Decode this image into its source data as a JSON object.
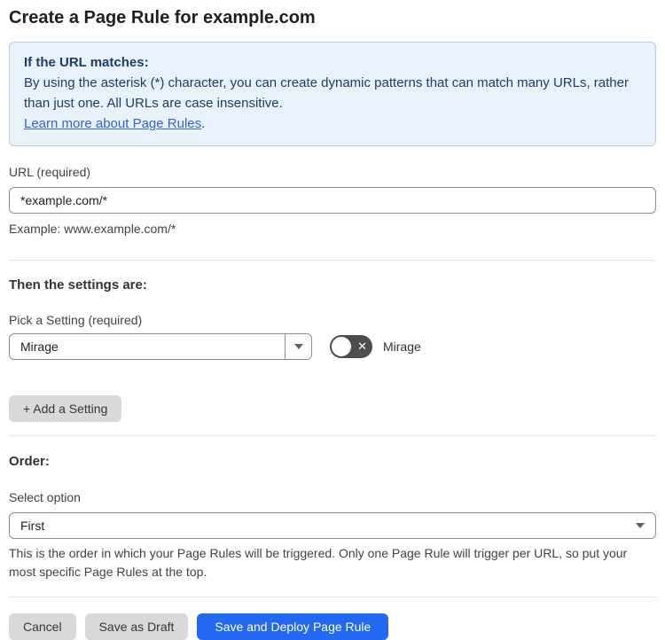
{
  "page": {
    "title": "Create a Page Rule for example.com"
  },
  "info_box": {
    "heading": "If the URL matches:",
    "body": "By using the asterisk (*) character, you can create dynamic patterns that can match many URLs, rather than just one. All URLs are case insensitive.",
    "link_label": "Learn more about Page Rules",
    "link_suffix": "."
  },
  "url_field": {
    "label": "URL (required)",
    "value": "*example.com/*",
    "helper": "Example: www.example.com/*"
  },
  "settings": {
    "heading": "Then the settings are:",
    "picker_label": "Pick a Setting (required)",
    "selected_setting": "Mirage",
    "toggle_label": "Mirage",
    "toggle_state": "off",
    "toggle_glyph": "✕",
    "add_setting_label": "+ Add a Setting"
  },
  "order": {
    "heading": "Order:",
    "select_label": "Select option",
    "selected_option": "First",
    "helper": "This is the order in which your Page Rules will be triggered. Only one Page Rule will trigger per URL, so put your most specific Page Rules at the top."
  },
  "footer": {
    "cancel_label": "Cancel",
    "save_draft_label": "Save as Draft",
    "save_deploy_label": "Save and Deploy Page Rule"
  },
  "colors": {
    "info_background": "#e9f1fb",
    "info_border": "#b3cfec",
    "info_text": "#1e3c6e",
    "link": "#3363d9",
    "primary_button": "#2268f2",
    "secondary_button": "#d9d9d9",
    "toggle_off": "#4d4d4d"
  }
}
